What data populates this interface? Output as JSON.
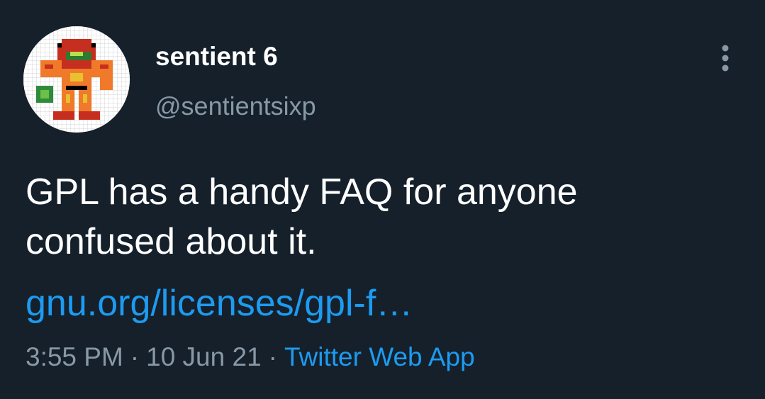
{
  "colors": {
    "background": "#15202b",
    "primary_text": "#ffffff",
    "secondary_text": "#8899a6",
    "link": "#1d9bf0"
  },
  "tweet": {
    "author": {
      "display_name": "sentient 6",
      "handle": "@sentientsixp",
      "avatar_icon": "pixel-art-character-avatar"
    },
    "more_icon": "more-vertical-icon",
    "text_lines": [
      "GPL has a handy FAQ for anyone",
      "confused about it."
    ],
    "link_text": "gnu.org/licenses/gpl-f…",
    "meta": {
      "time": "3:55 PM",
      "separator": "·",
      "date": "10 Jun 21",
      "source": "Twitter Web App"
    }
  }
}
